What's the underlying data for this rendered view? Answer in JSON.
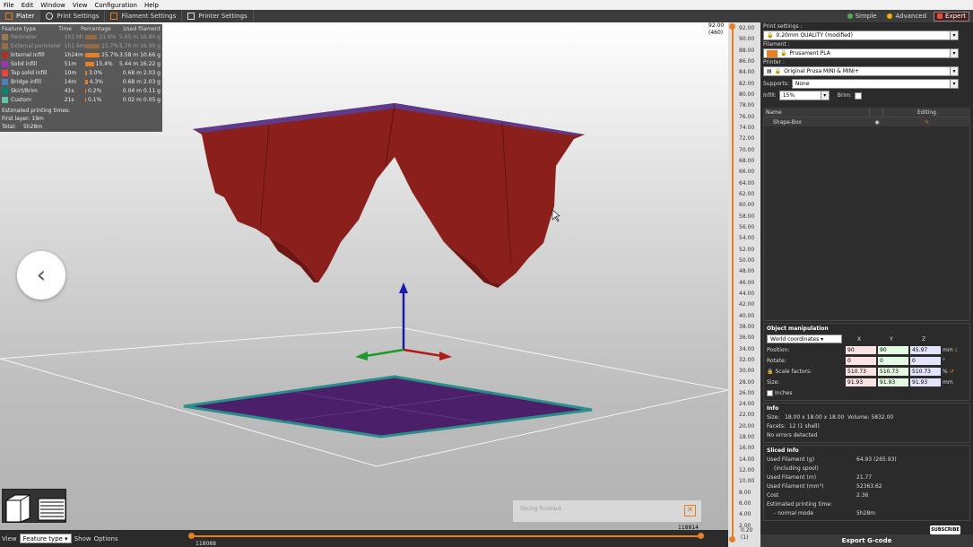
{
  "menu": [
    "File",
    "Edit",
    "Window",
    "View",
    "Configuration",
    "Help"
  ],
  "tabs": [
    "Plater",
    "Print Settings",
    "Filament Settings",
    "Printer Settings"
  ],
  "modes": [
    {
      "label": "Simple",
      "color": "#4caf50"
    },
    {
      "label": "Advanced",
      "color": "#f0b400"
    },
    {
      "label": "Expert",
      "color": "#e74c3c"
    }
  ],
  "legend": {
    "headers": [
      "Feature type",
      "Time",
      "Percentage",
      "Used filament"
    ],
    "rows": [
      {
        "name": "Perimeter",
        "time": "1h1 hh",
        "pct": "21.6%",
        "len": "5.65 m",
        "weight": "16.84 g",
        "color": "#d9a84e",
        "bar": 0.84,
        "dim": true
      },
      {
        "name": "External perimeter",
        "time": "1h1 6m",
        "pct": "25.7%",
        "len": "5.70 m",
        "weight": "16.99 g",
        "color": "#e08a3a",
        "bar": 1.0,
        "dim": true
      },
      {
        "name": "Internal infill",
        "time": "1h24m",
        "pct": "25.7%",
        "len": "3.58 m",
        "weight": "10.66 g",
        "color": "#b03029",
        "bar": 1.0
      },
      {
        "name": "Solid infill",
        "time": "51m",
        "pct": "15.4%",
        "len": "5.44 m",
        "weight": "16.22 g",
        "color": "#9b35b5",
        "bar": 0.6
      },
      {
        "name": "Top solid infill",
        "time": "10m",
        "pct": "3.0%",
        "len": "0.68 m",
        "weight": "2.03 g",
        "color": "#f04040",
        "bar": 0.12
      },
      {
        "name": "Bridge infill",
        "time": "14m",
        "pct": "4.3%",
        "len": "0.68 m",
        "weight": "2.03 g",
        "color": "#4a7fb8",
        "bar": 0.17
      },
      {
        "name": "Skirt/Brim",
        "time": "41s",
        "pct": "0.2%",
        "len": "0.04 m",
        "weight": "0.11 g",
        "color": "#00876e",
        "bar": 0.02
      },
      {
        "name": "Custom",
        "time": "21s",
        "pct": "0.1%",
        "len": "0.02 m",
        "weight": "0.05 g",
        "color": "#5ec5a8",
        "bar": 0.01
      }
    ],
    "est_title": "Estimated printing times:",
    "first_layer": "First layer: 19m",
    "total_label": "Total:",
    "total_value": "5h28m"
  },
  "nav": {
    "prev": "‹",
    "next": "›"
  },
  "toast": {
    "text": "Slicing finished.",
    "close": "✕"
  },
  "bottom": {
    "view_label": "View",
    "view_value": "Feature type",
    "show_label": "Show",
    "options_label": "Options",
    "hslider_left": "118088",
    "hslider_right": "118814"
  },
  "vslider": {
    "top_value": "92.00",
    "top_layer": "(460)",
    "bottom_value": "0.20",
    "bottom_layer": "(1)",
    "ticks": [
      "92.00",
      "90.00",
      "88.00",
      "86.00",
      "84.00",
      "82.00",
      "80.00",
      "78.00",
      "76.00",
      "74.00",
      "72.00",
      "70.00",
      "68.00",
      "66.00",
      "64.00",
      "62.00",
      "60.00",
      "58.00",
      "56.00",
      "54.00",
      "52.00",
      "50.00",
      "48.00",
      "46.00",
      "44.00",
      "42.00",
      "40.00",
      "38.00",
      "36.00",
      "34.00",
      "32.00",
      "30.00",
      "28.00",
      "26.00",
      "24.00",
      "22.00",
      "20.00",
      "18.00",
      "16.00",
      "14.00",
      "12.00",
      "10.00",
      "8.00",
      "6.00",
      "4.00",
      "2.00"
    ]
  },
  "right": {
    "print_label": "Print settings :",
    "print_value": "0.20mm QUALITY (modified)",
    "filament_label": "Filament :",
    "filament_value": "Prusament PLA",
    "filament_color": "#e67e22",
    "printer_label": "Printer :",
    "printer_value": "Original Prusa MINI & MINI+",
    "supports_label": "Supports:",
    "supports_value": "None",
    "infill_label": "Infill:",
    "infill_value": "15%",
    "brim_label": "Brim:",
    "list_name": "Name",
    "list_editing": "Editing",
    "object_name": "Shape-Box",
    "om_title": "Object manipulation",
    "om_coords": "World coordinates",
    "axes": [
      "X",
      "Y",
      "Z"
    ],
    "position_label": "Position:",
    "position": [
      "90",
      "90",
      "45.97"
    ],
    "position_unit": "mm",
    "rotate_label": "Rotate:",
    "rotate": [
      "0",
      "0",
      "0"
    ],
    "rotate_unit": "°",
    "scale_label": "Scale factors:",
    "scale": [
      "510.73",
      "510.73",
      "510.73"
    ],
    "scale_unit": "%",
    "size_label": "Size:",
    "size": [
      "91.93",
      "91.93",
      "91.93"
    ],
    "size_unit": "mm",
    "inches_label": "Inches",
    "info_title": "Info",
    "info_size_label": "Size:",
    "info_size": "18.00 x 18.00 x 18.00",
    "info_volume_label": "Volume:",
    "info_volume": "5832.00",
    "info_facets_label": "Facets:",
    "info_facets": "12 (1 shell)",
    "info_errors": "No errors detected",
    "sliced_title": "Sliced Info",
    "sliced_rows": [
      {
        "label": "Used Filament (g)",
        "value": "64.93 (265.93)"
      },
      {
        "label": "(including spool)",
        "value": ""
      },
      {
        "label": "Used Filament (m)",
        "value": "21.77"
      },
      {
        "label": "Used Filament (mm³)",
        "value": "52363.62"
      },
      {
        "label": "Cost",
        "value": "2.36"
      },
      {
        "label": "Estimated printing time:",
        "value": ""
      },
      {
        "label": "- normal mode",
        "value": "5h28m"
      }
    ],
    "export": "Export G-code",
    "subscribe": "SUBSCRIBE"
  }
}
